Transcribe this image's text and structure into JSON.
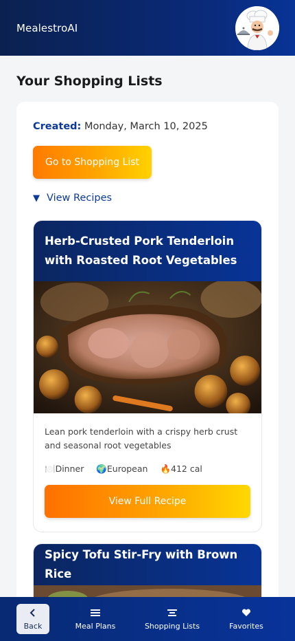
{
  "header": {
    "app_title": "MealestroAI"
  },
  "page": {
    "title": "Your Shopping Lists"
  },
  "shopping_list": {
    "created_label": "Created:",
    "created_date": "Monday, March 10, 2025",
    "go_button": "Go to Shopping List",
    "view_recipes": "View Recipes",
    "view_recipes_icon": "triangle-down-icon"
  },
  "recipes": [
    {
      "title": "Herb-Crusted Pork Tenderloin with Roasted Root Vegetables",
      "description": "Lean pork tenderloin with a crispy herb crust and seasonal root vegetables",
      "meal_type": "🍽️Dinner",
      "cuisine": "🌍European",
      "calories": "🔥412 cal",
      "button": "View Full Recipe"
    },
    {
      "title": "Spicy Tofu Stir-Fry with Brown Rice"
    }
  ],
  "nav": {
    "back": "Back",
    "meal_plans": "Meal Plans",
    "shopping_lists": "Shopping Lists",
    "favorites": "Favorites"
  },
  "colors": {
    "brand_navy": "#0a2a7a",
    "accent_orange": "#ff7a00",
    "accent_yellow": "#ffd200",
    "link_blue": "#0b3a9a"
  }
}
